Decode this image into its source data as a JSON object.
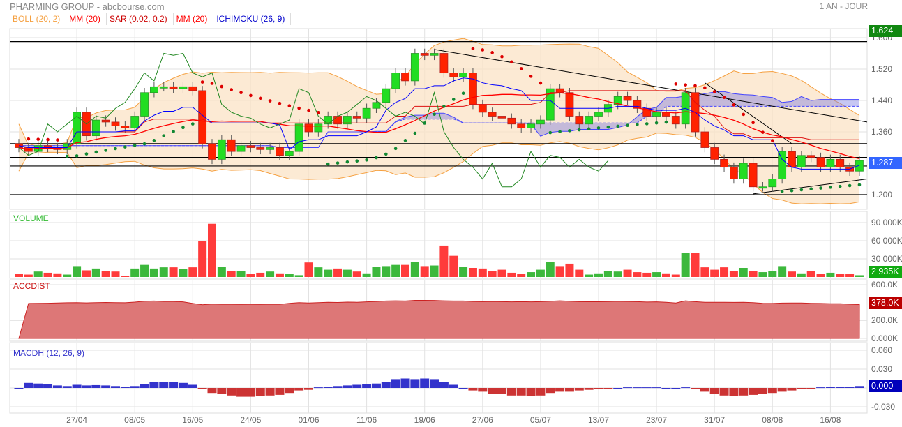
{
  "header": {
    "title": "PHARMING GROUP - abcbourse.com",
    "period": "1 AN - JOUR"
  },
  "legend": [
    {
      "label": "BOLL (20, 2)",
      "color": "#f5a040"
    },
    {
      "label": "MM (20)",
      "color": "#ff0000"
    },
    {
      "label": "SAR (0.02, 0.2)",
      "color": "#cc0000"
    },
    {
      "label": "MM (20)",
      "color": "#ff0000"
    },
    {
      "label": "ICHIMOKU (26, 9)",
      "color": "#0000cc"
    }
  ],
  "panels": {
    "volume": "VOLUME",
    "accdist": "ACCDIST",
    "macdh": "MACDH (12, 26, 9)"
  },
  "badges": {
    "high": "1.624",
    "last": "1.287",
    "volume": "2 935K",
    "accdist": "378.0K",
    "macdh": "0.000"
  },
  "chart_data": {
    "type": "candlestick",
    "price_ticks": [
      {
        "v": 1.6,
        "label": "1.600"
      },
      {
        "v": 1.52,
        "label": "1.520"
      },
      {
        "v": 1.44,
        "label": "1.440"
      },
      {
        "v": 1.36,
        "label": "1.360"
      },
      {
        "v": 1.2,
        "label": "1.200"
      }
    ],
    "volume_ticks": [
      {
        "v": 90000,
        "label": "90 000K"
      },
      {
        "v": 60000,
        "label": "60 000K"
      },
      {
        "v": 30000,
        "label": "30 000K"
      }
    ],
    "accdist_ticks": [
      {
        "v": 600,
        "label": "600.0K"
      },
      {
        "v": 200,
        "label": "200.0K"
      },
      {
        "v": 0,
        "label": "0.000K"
      }
    ],
    "macdh_ticks": [
      {
        "v": 0.06,
        "label": "0.060"
      },
      {
        "v": 0.03,
        "label": "0.030"
      },
      {
        "v": -0.03,
        "label": "-0.030"
      }
    ],
    "x_labels": [
      {
        "i": 6,
        "label": "27/04"
      },
      {
        "i": 12,
        "label": "08/05"
      },
      {
        "i": 18,
        "label": "16/05"
      },
      {
        "i": 24,
        "label": "24/05"
      },
      {
        "i": 30,
        "label": "01/06"
      },
      {
        "i": 36,
        "label": "11/06"
      },
      {
        "i": 42,
        "label": "19/06"
      },
      {
        "i": 48,
        "label": "27/06"
      },
      {
        "i": 54,
        "label": "05/07"
      },
      {
        "i": 60,
        "label": "13/07"
      },
      {
        "i": 66,
        "label": "23/07"
      },
      {
        "i": 72,
        "label": "31/07"
      },
      {
        "i": 78,
        "label": "08/08"
      },
      {
        "i": 84,
        "label": "16/08"
      }
    ],
    "close": [
      1.32,
      1.31,
      1.325,
      1.32,
      1.315,
      1.33,
      1.41,
      1.35,
      1.39,
      1.385,
      1.375,
      1.37,
      1.4,
      1.46,
      1.475,
      1.475,
      1.47,
      1.475,
      1.465,
      1.33,
      1.29,
      1.34,
      1.31,
      1.325,
      1.32,
      1.315,
      1.32,
      1.3,
      1.31,
      1.38,
      1.36,
      1.38,
      1.4,
      1.38,
      1.4,
      1.395,
      1.42,
      1.435,
      1.47,
      1.51,
      1.49,
      1.56,
      1.555,
      1.56,
      1.51,
      1.5,
      1.51,
      1.43,
      1.41,
      1.4,
      1.395,
      1.38,
      1.37,
      1.38,
      1.39,
      1.47,
      1.46,
      1.4,
      1.38,
      1.4,
      1.41,
      1.43,
      1.45,
      1.44,
      1.42,
      1.4,
      1.41,
      1.4,
      1.38,
      1.46,
      1.36,
      1.32,
      1.29,
      1.27,
      1.24,
      1.28,
      1.22,
      1.22,
      1.24,
      1.31,
      1.27,
      1.3,
      1.295,
      1.27,
      1.29,
      1.27,
      1.26,
      1.287
    ],
    "volume_k": [
      5000,
      4000,
      9000,
      7000,
      6000,
      4000,
      18000,
      11000,
      14000,
      10000,
      9000,
      2000,
      14000,
      20000,
      14000,
      16000,
      16000,
      13000,
      16000,
      60000,
      88000,
      17000,
      10000,
      10000,
      5000,
      7000,
      9000,
      6000,
      5000,
      3000,
      24000,
      16000,
      12000,
      14000,
      12000,
      9000,
      6000,
      17000,
      18000,
      20000,
      20000,
      25000,
      18000,
      19000,
      52000,
      35000,
      17000,
      15000,
      14000,
      10000,
      12000,
      7000,
      5000,
      8000,
      12000,
      25000,
      18000,
      22000,
      12000,
      4000,
      6000,
      10000,
      9000,
      12000,
      8000,
      7000,
      8000,
      6000,
      4000,
      40000,
      40000,
      16000,
      12000,
      16000,
      10000,
      15000,
      10000,
      8000,
      10000,
      18000,
      9000,
      6000,
      10000,
      5000,
      7000,
      5000,
      5000,
      2935
    ],
    "accdist_k": [
      0,
      390,
      392,
      393,
      395,
      398,
      400,
      397,
      400,
      401,
      399,
      398,
      405,
      415,
      418,
      412,
      412,
      408,
      390,
      376,
      383,
      381,
      381,
      380,
      381,
      380,
      381,
      381,
      392,
      400,
      396,
      400,
      404,
      401,
      405,
      404,
      408,
      412,
      418,
      420,
      418,
      425,
      425,
      424,
      420,
      418,
      418,
      412,
      410,
      412,
      410,
      408,
      410,
      408,
      410,
      415,
      420,
      415,
      410,
      409,
      409,
      411,
      414,
      412,
      410,
      406,
      408,
      403,
      396,
      420,
      410,
      404,
      404,
      403,
      402,
      404,
      400,
      392,
      390,
      394,
      396,
      395,
      392,
      390,
      388,
      387,
      382,
      378
    ],
    "macdh": [
      0,
      0.008,
      0.007,
      0.006,
      0.004,
      0.003,
      0.005,
      0.004,
      0.0045,
      0.004,
      0.003,
      0.002,
      0.003,
      0.006,
      0.009,
      0.01,
      0.009,
      0.008,
      0.005,
      -0.001,
      -0.008,
      -0.01,
      -0.012,
      -0.014,
      -0.014,
      -0.013,
      -0.012,
      -0.011,
      -0.008,
      -0.004,
      -0.003,
      0.001,
      0.002,
      0.003,
      0.004,
      0.005,
      0.006,
      0.007,
      0.009,
      0.014,
      0.015,
      0.014,
      0.015,
      0.014,
      0.01,
      0.005,
      0,
      -0.004,
      -0.006,
      -0.009,
      -0.01,
      -0.012,
      -0.012,
      -0.013,
      -0.012,
      -0.008,
      -0.006,
      -0.006,
      -0.004,
      -0.003,
      -0.002,
      -0.001,
      0,
      0.001,
      0.001,
      0.001,
      0.001,
      0,
      0,
      0.001,
      -0.002,
      -0.006,
      -0.01,
      -0.012,
      -0.013,
      -0.012,
      -0.011,
      -0.01,
      -0.008,
      -0.006,
      -0.004,
      -0.002,
      -0.001,
      0.001,
      0.002,
      0.002,
      0.002,
      0.003
    ],
    "horizontal_levels": [
      1.59,
      1.33,
      1.295,
      1.273,
      1.2
    ],
    "colors": {
      "up": "#22dd22",
      "down": "#ff2200",
      "boll": "#f5a040",
      "mm": "#ff0000",
      "sar_up": "#118833",
      "sar_down": "#dd0000",
      "ichimoku": "#0000ff",
      "chikou": "#228822"
    }
  }
}
